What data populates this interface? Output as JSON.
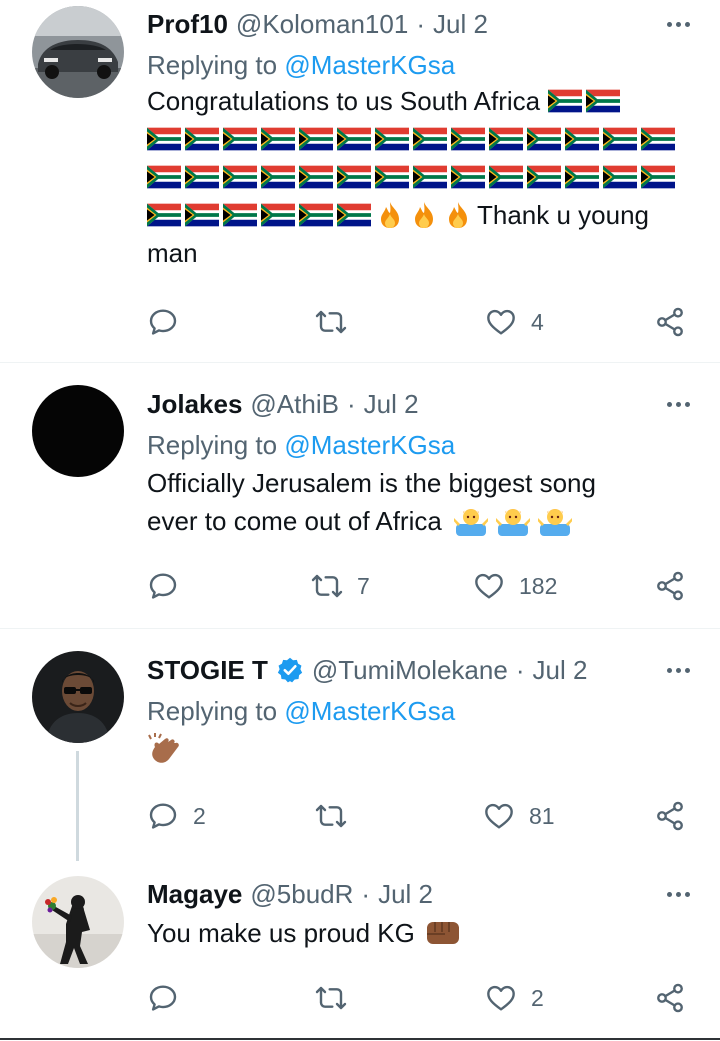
{
  "tweets": [
    {
      "name": "Prof10",
      "handle": "@Koloman101",
      "date": "Jul 2",
      "replying_prefix": "Replying to",
      "replying_to": "@MasterKGsa",
      "text_start": "Congratulations to us South Africa",
      "text_end_a": "Thank u young",
      "text_end_b": "man",
      "reply_count": "",
      "retweet_count": "",
      "like_count": "4"
    },
    {
      "name": "Jolakes",
      "handle": "@AthiB",
      "date": "Jul 2",
      "replying_prefix": "Replying to",
      "replying_to": "@MasterKGsa",
      "text_line1": "Officially Jerusalem is the biggest song",
      "text_line2": "ever to come out of Africa",
      "reply_count": "",
      "retweet_count": "7",
      "like_count": "182"
    },
    {
      "name": "STOGIE T",
      "handle": "@TumiMolekane",
      "date": "Jul 2",
      "replying_prefix": "Replying to",
      "replying_to": "@MasterKGsa",
      "reply_count": "2",
      "retweet_count": "",
      "like_count": "81"
    },
    {
      "name": "Magaye",
      "handle": "@5budR",
      "date": "Jul 2",
      "text": "You make us proud KG",
      "reply_count": "",
      "retweet_count": "",
      "like_count": "2"
    }
  ],
  "colors": {
    "link": "#1d9bf0",
    "secondary": "#536471",
    "verified": "#1d9bf0"
  },
  "icons": [
    "reply-icon",
    "retweet-icon",
    "like-icon",
    "share-icon",
    "more-icon",
    "verified-badge-icon"
  ]
}
